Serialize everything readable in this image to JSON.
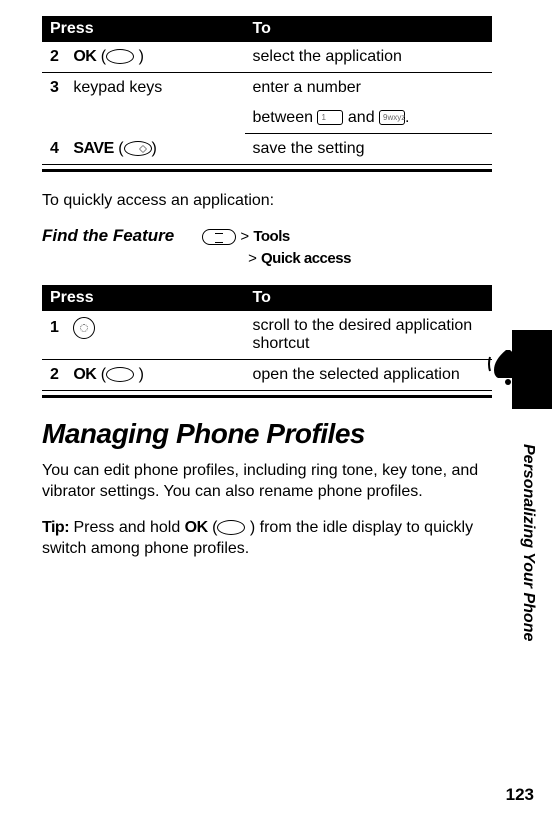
{
  "table1": {
    "headers": {
      "press": "Press",
      "to": "To"
    },
    "rows": [
      {
        "step": "2",
        "key_label": "OK",
        "icon": "oval",
        "to": "select the application"
      },
      {
        "step": "3",
        "key_label_plain": "keypad keys",
        "to_line1": "enter a number",
        "to_line2_pre": "between ",
        "to_line2_mid": " and ",
        "key1_text": "1",
        "key9_text": "9wxyz"
      },
      {
        "step": "4",
        "key_label": "SAVE",
        "icon": "oval-softkey",
        "to": "save the setting"
      }
    ]
  },
  "quick_access_intro": "To quickly access an application:",
  "feature": {
    "label": "Find the Feature",
    "path1_pre": "> ",
    "path1": "Tools",
    "path2_pre": "> ",
    "path2": "Quick access"
  },
  "table2": {
    "headers": {
      "press": "Press",
      "to": "To"
    },
    "rows": [
      {
        "step": "1",
        "icon": "nav-circle",
        "to": "scroll to the desired application shortcut"
      },
      {
        "step": "2",
        "key_label": "OK",
        "icon": "oval",
        "to": "open the selected application"
      }
    ]
  },
  "heading": "Managing Phone Profiles",
  "body_p1": "You can edit phone profiles, including ring tone, key tone, and vibrator settings. You can also rename phone profiles.",
  "tip_label": "Tip:",
  "tip_pre": " Press and hold ",
  "tip_ok": "OK",
  "tip_post": " ) from the idle display to quickly switch among phone profiles.",
  "side_text": "Personalizing Your Phone",
  "page_number": "123"
}
